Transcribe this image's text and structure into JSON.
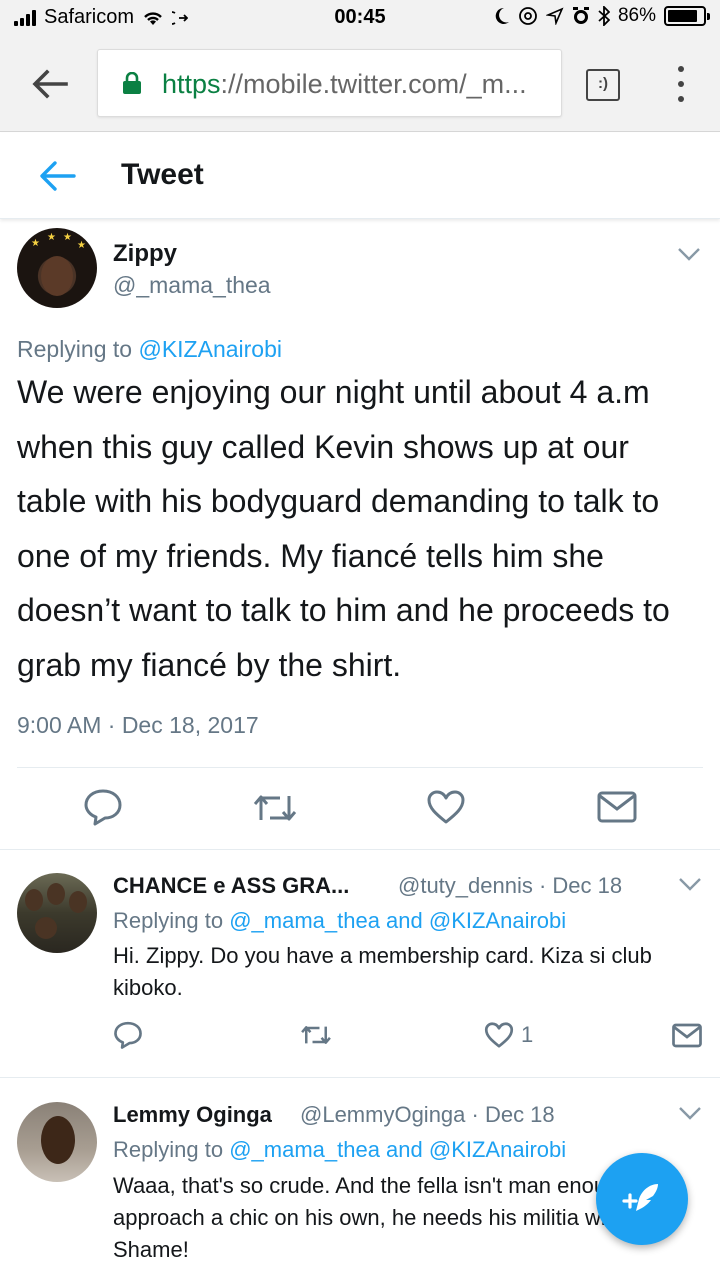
{
  "status_bar": {
    "carrier": "Safaricom",
    "time": "00:45",
    "battery": "86%",
    "battery_level": 0.86
  },
  "browser": {
    "url_scheme": "https",
    "url_rest": "://mobile.twitter.com/_m...",
    "tabs_glyph": ":)"
  },
  "header": {
    "title": "Tweet"
  },
  "main_tweet": {
    "name": "Zippy",
    "handle": "@_mama_thea",
    "replying_prefix": "Replying to ",
    "replying_to": "@KIZAnairobi",
    "text": "We were enjoying our night until about 4 a.m when this guy called Kevin shows up at our table with his bodyguard demanding to talk to one of my friends. My fiancé tells him she doesn’t want to talk to him and he proceeds to grab my fiancé by the shirt.",
    "timestamp": "9:00 AM · Dec 18, 2017"
  },
  "replies": [
    {
      "name": "CHANCE e ASS GRA...",
      "meta": "@tuty_dennis · Dec 18",
      "replying_prefix": "Replying to ",
      "replying_to": "@_mama_thea and @KIZAnairobi",
      "text": "Hi. Zippy. Do you have a membership card. Kiza si club kiboko.",
      "likes": "1"
    },
    {
      "name": "Lemmy Oginga",
      "meta": "@LemmyOginga · Dec 18",
      "replying_prefix": "Replying to ",
      "replying_to": "@_mama_thea and @KIZAnairobi",
      "text": "Waaa, that's so crude. And the fella isn't man enough to approach a chic on his own, he needs his militia with him. Shame!"
    }
  ],
  "colors": {
    "accent": "#1da1f2",
    "secondary_text": "#657786",
    "secure_green": "#0b8043"
  },
  "icons": [
    "signal-icon",
    "wifi-icon",
    "vpn-icon",
    "moon-icon",
    "at-icon",
    "location-icon",
    "alarm-icon",
    "bluetooth-icon",
    "battery-icon",
    "back-arrow-icon",
    "lock-icon",
    "tabs-icon",
    "menu-icon",
    "reply-icon",
    "retweet-icon",
    "like-icon",
    "share-icon",
    "chevron-down-icon",
    "compose-icon"
  ]
}
